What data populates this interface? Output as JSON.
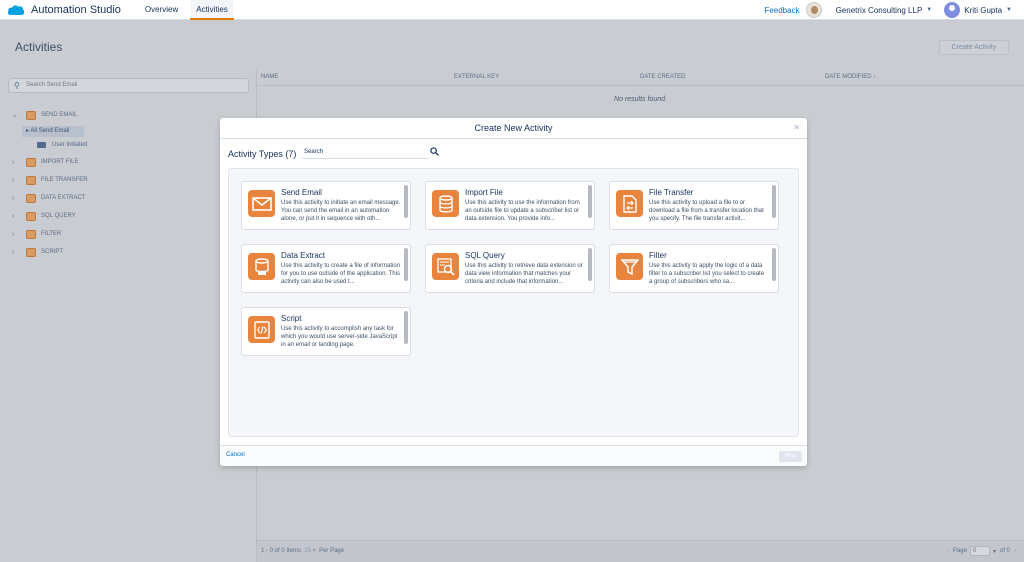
{
  "app": {
    "title": "Automation Studio",
    "tabs": [
      {
        "label": "Overview",
        "active": false
      },
      {
        "label": "Activities",
        "active": true
      }
    ],
    "feedback": "Feedback",
    "org": "Genetrix Consulting LLP",
    "user": "Kriti Gupta",
    "accent": "#e07b00",
    "brand": "#00a1e0"
  },
  "page": {
    "title": "Activities",
    "create_button": "Create Activity"
  },
  "sidebar": {
    "search_placeholder": "Search Send Email",
    "items": [
      {
        "label": "SEND EMAIL",
        "expanded": true
      },
      {
        "label": "IMPORT FILE",
        "expanded": false
      },
      {
        "label": "FILE TRANSFER",
        "expanded": false
      },
      {
        "label": "DATA EXTRACT",
        "expanded": false
      },
      {
        "label": "SQL QUERY",
        "expanded": false
      },
      {
        "label": "FILTER",
        "expanded": false
      },
      {
        "label": "SCRIPT",
        "expanded": false
      }
    ],
    "selected_sub": "All Send Email",
    "sub_folder": "User Initiated"
  },
  "table": {
    "columns": [
      "NAME",
      "EXTERNAL KEY",
      "DATE CREATED",
      "DATE MODIFIED ↓"
    ],
    "empty_message": "No results found."
  },
  "pagination": {
    "items": "1 - 0 of 0 Items",
    "per_page_value": "25",
    "per_page_label": "Per Page",
    "page_label": "Page",
    "page_value": "0",
    "of_label": "of 0"
  },
  "modal": {
    "title": "Create New Activity",
    "types_label": "Activity Types (7)",
    "search_placeholder": "Search",
    "cancel": "Cancel",
    "next": "Next",
    "cards": [
      {
        "title": "Send Email",
        "icon": "envelope-icon",
        "desc": "Use this activity to initiate an email message. You can send the email in an automation alone, or put it in sequence with oth..."
      },
      {
        "title": "Import File",
        "icon": "database-import-icon",
        "desc": "Use this activity to use the information from an outside file to update a subscriber list or data extension. You provide info..."
      },
      {
        "title": "File Transfer",
        "icon": "file-transfer-icon",
        "desc": "Use this activity to upload a file to or download a file from a transfer location that you specify. The file transfer activit..."
      },
      {
        "title": "Data Extract",
        "icon": "data-extract-icon",
        "desc": "Use this activity to create a file of information for you to use outside of the application. This activity can also be used t..."
      },
      {
        "title": "SQL Query",
        "icon": "sql-query-icon",
        "desc": "Use this activity to retrieve data extension or data view information that matches your criteria and include that information..."
      },
      {
        "title": "Filter",
        "icon": "funnel-icon",
        "desc": "Use this activity to apply the logic of a data filter to a subscriber list you select to create a group of subscribers who sa..."
      },
      {
        "title": "Script",
        "icon": "script-icon",
        "desc": "Use this activity to accomplish any task for which you would use server-side JavaScript in an email or landing page."
      }
    ]
  }
}
